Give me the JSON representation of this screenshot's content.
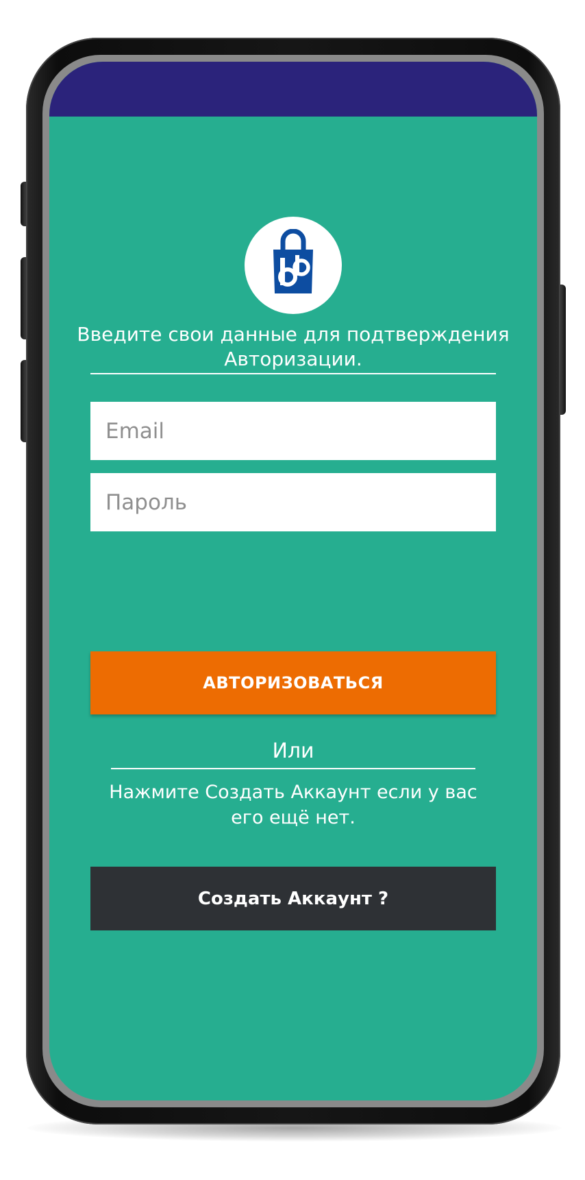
{
  "colors": {
    "status_bar": "#2b237b",
    "background": "#26ae90",
    "primary_button": "#ed6c02",
    "secondary_button": "#2e3135",
    "logo_blue": "#0d4da1"
  },
  "logo": {
    "icon": "shopping-bag-bb-logo"
  },
  "intro": {
    "text": "Введите свои данные для подтверждения Авторизации."
  },
  "form": {
    "email_placeholder": "Email",
    "password_placeholder": "Пароль"
  },
  "buttons": {
    "login_label": "АВТОРИЗОВАТЬСЯ",
    "create_account_label": "Создать Аккаунт ?"
  },
  "separator": {
    "or_text": "Или",
    "hint_text": "Нажмите Создать Аккаунт если у вас его ещё нет."
  }
}
